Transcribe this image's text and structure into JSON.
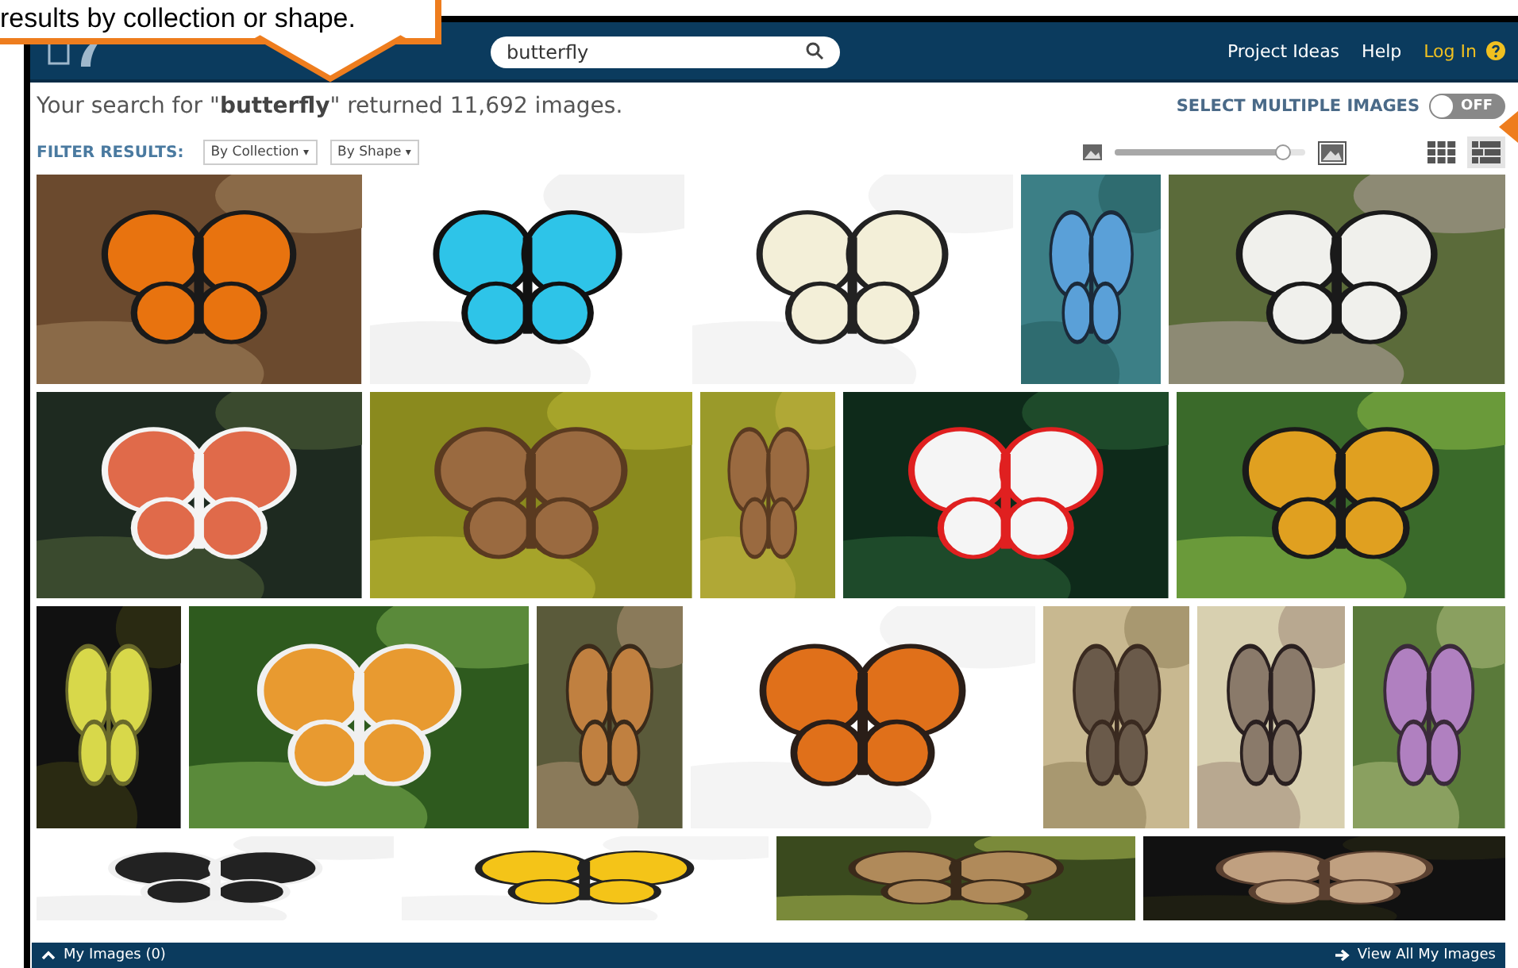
{
  "callout": {
    "text": "results by collection or shape."
  },
  "header": {
    "search": {
      "value": "butterfly"
    },
    "links": [
      {
        "label": "Project Ideas",
        "kind": "plain"
      },
      {
        "label": "Help",
        "kind": "plain"
      },
      {
        "label": "Log In",
        "kind": "login"
      }
    ]
  },
  "summary": {
    "text": "Your search for \"**butterfly**\" returned 11,692 images."
  },
  "select_multiple": {
    "label": "SELECT MULTIPLE IMAGES",
    "toggle": {
      "text": "OFF",
      "on": false
    }
  },
  "filter": {
    "label": "FILTER RESULTS:",
    "dropdowns": [
      {
        "label": "By Collection",
        "caret": "▾"
      },
      {
        "label": "By Shape",
        "caret": "▾"
      }
    ]
  },
  "size_slider": {
    "level": 0.88
  },
  "views": [
    {
      "kind": "large-grid",
      "selected": false
    },
    {
      "kind": "list-grid",
      "selected": true
    }
  ],
  "bottom_bar": {
    "my_images": "My Images (0)",
    "view_all": "View All My Images"
  }
}
